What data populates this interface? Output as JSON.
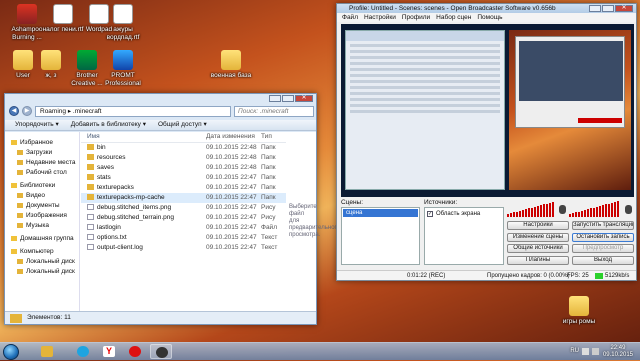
{
  "desktop": {
    "icons": [
      {
        "label": "Ashampoo Burning ...",
        "glyph": "ashampoo-app-icon"
      },
      {
        "label": "налог пени.rtf",
        "glyph": "rtf-document-icon"
      },
      {
        "label": "Wordpad",
        "glyph": "wordpad-icon"
      },
      {
        "label": "ажуры вордпад.rtf",
        "glyph": "rtf-document-icon"
      },
      {
        "label": "User",
        "glyph": "folder-icon"
      },
      {
        "label": "ж, з",
        "glyph": "folder-icon"
      },
      {
        "label": "Brother Creative ...",
        "glyph": "brother-app-icon"
      },
      {
        "label": "PROMT Professional",
        "glyph": "promt-app-icon"
      },
      {
        "label": "военная база",
        "glyph": "folder-icon"
      },
      {
        "label": "игры ромы",
        "glyph": "folder-icon"
      }
    ]
  },
  "explorer": {
    "breadcrumb": [
      "Roaming",
      ".minecraft"
    ],
    "search_placeholder": "Поиск: .minecraft",
    "toolbar": [
      "Упорядочить ▾",
      "Добавить в библиотеку ▾",
      "Общий доступ ▾"
    ],
    "columns": {
      "name": "Имя",
      "date": "Дата изменения",
      "type": "Тип"
    },
    "sidebar": [
      {
        "label": "Избранное",
        "group": true
      },
      {
        "label": "Загрузки",
        "group": false
      },
      {
        "label": "Недавние места",
        "group": false
      },
      {
        "label": "Рабочий стол",
        "group": false
      },
      {
        "label": "Библиотеки",
        "group": true
      },
      {
        "label": "Видео",
        "group": false
      },
      {
        "label": "Документы",
        "group": false
      },
      {
        "label": "Изображения",
        "group": false
      },
      {
        "label": "Музыка",
        "group": false
      },
      {
        "label": "Домашняя группа",
        "group": true
      },
      {
        "label": "Компьютер",
        "group": true
      },
      {
        "label": "Локальный диск",
        "group": false
      },
      {
        "label": "Локальный диск",
        "group": false
      }
    ],
    "files": [
      {
        "name": "bin",
        "date": "09.10.2015 22:48",
        "type": "Папк",
        "kind": "folder"
      },
      {
        "name": "resources",
        "date": "09.10.2015 22:48",
        "type": "Папк",
        "kind": "folder"
      },
      {
        "name": "saves",
        "date": "09.10.2015 22:48",
        "type": "Папк",
        "kind": "folder"
      },
      {
        "name": "stats",
        "date": "09.10.2015 22:47",
        "type": "Папк",
        "kind": "folder"
      },
      {
        "name": "texturepacks",
        "date": "09.10.2015 22:47",
        "type": "Папк",
        "kind": "folder"
      },
      {
        "name": "texturepacks-mp-cache",
        "date": "09.10.2015 22:47",
        "type": "Папк",
        "kind": "folder"
      },
      {
        "name": "debug.stitched_items.png",
        "date": "09.10.2015 22:47",
        "type": "Рису",
        "kind": "file"
      },
      {
        "name": "debug.stitched_terrain.png",
        "date": "09.10.2015 22:47",
        "type": "Рису",
        "kind": "file"
      },
      {
        "name": "lastlogin",
        "date": "09.10.2015 22:47",
        "type": "Файл",
        "kind": "file"
      },
      {
        "name": "options.txt",
        "date": "09.10.2015 22:47",
        "type": "Текст",
        "kind": "file"
      },
      {
        "name": "output-client.log",
        "date": "09.10.2015 22:47",
        "type": "Текст",
        "kind": "file"
      }
    ],
    "highlighted_index": 5,
    "preview_hint": "Выберите файл для предварительного просмотра.",
    "status": "Элементов: 11"
  },
  "obs": {
    "title": "Profile: Untitled - Scenes: scenes - Open Broadcaster Software v0.656b",
    "menu": [
      "Файл",
      "Настройки",
      "Профили",
      "Набор сцен",
      "Помощь"
    ],
    "scenes_label": "Сцены:",
    "scene_selected": "сцена",
    "sources_label": "Источники:",
    "source": {
      "label": "Область экрана",
      "checked": true
    },
    "buttons": {
      "settings": "Настройки",
      "start_stream": "Запустить трансляцию",
      "edit_scene": "Изменение сцены",
      "stop_record": "Остановить запись",
      "global_sources": "Общие источники",
      "preview": "Предпросмотр",
      "plugins": "Плагины",
      "exit": "Выход"
    },
    "status": {
      "time": "0:01:22 (REC)",
      "dropped": "Пропущено кадров: 0 (0.00%)",
      "fps": "FPS: 25",
      "bitrate": "5129kb/s"
    }
  },
  "taskbar": {
    "apps": [
      "explorer-icon",
      "yandex-browser-icon",
      "skype-icon",
      "opera-icon",
      "obs-icon",
      "wordpad-icon",
      "media-player-icon"
    ],
    "lang": "RU",
    "time": "22:49",
    "date": "09.10.2015"
  },
  "colors": {
    "accent": "#3575d3",
    "rec_meter": "#cc0000",
    "bitrate_ok": "#2bd02b"
  }
}
